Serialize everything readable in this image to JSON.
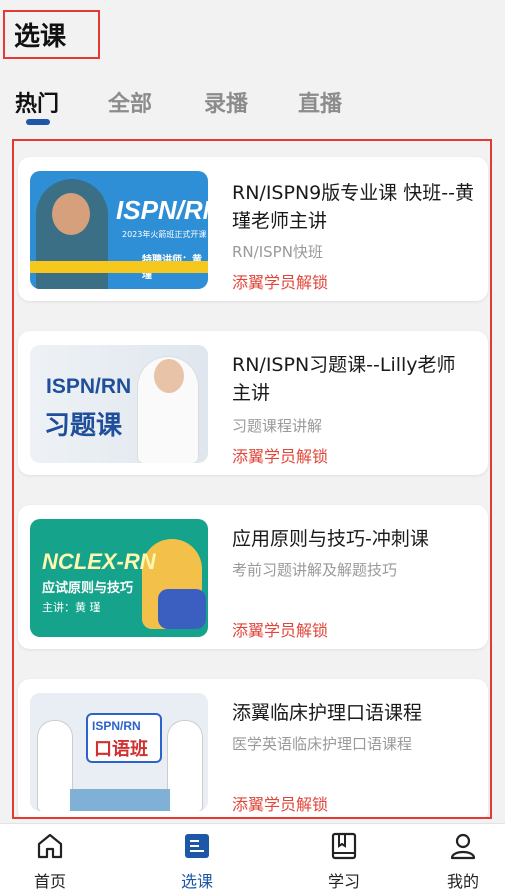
{
  "header": {
    "title": "选课"
  },
  "tabs": [
    {
      "label": "热门",
      "active": true
    },
    {
      "label": "全部",
      "active": false
    },
    {
      "label": "录播",
      "active": false
    },
    {
      "label": "直播",
      "active": false
    }
  ],
  "courses": [
    {
      "title": "RN/ISPN9版专业课 快班--黄瑾老师主讲",
      "subtitle": "RN/ISPN快班",
      "action": "添翼学员解锁",
      "thumb": {
        "line1": "ISPN/RN",
        "line2": "2023年火箭班正式开课",
        "line3": "特聘讲师：黄瑾"
      }
    },
    {
      "title": "RN/ISPN习题课--Lilly老师主讲",
      "subtitle": "习题课程讲解",
      "action": "添翼学员解锁",
      "thumb": {
        "line1": "ISPN/RN",
        "line2": "习题课"
      }
    },
    {
      "title": "应用原则与技巧-冲刺课",
      "subtitle": "考前习题讲解及解题技巧",
      "action": "添翼学员解锁",
      "thumb": {
        "line1": "NCLEX-RN",
        "line2": "应试原则与技巧",
        "line3": "主讲：黄 瑾"
      }
    },
    {
      "title": "添翼临床护理口语课程",
      "subtitle": "医学英语临床护理口语课程",
      "action": "添翼学员解锁",
      "thumb": {
        "line1": "ISPN/RN",
        "line2": "口语班"
      }
    }
  ],
  "bottom_nav": [
    {
      "label": "首页",
      "icon": "home-icon",
      "active": false
    },
    {
      "label": "选课",
      "icon": "course-list-icon",
      "active": true
    },
    {
      "label": "学习",
      "icon": "book-icon",
      "active": false
    },
    {
      "label": "我的",
      "icon": "user-icon",
      "active": false
    }
  ],
  "colors": {
    "accent": "#1e57a8",
    "lock": "#e0463b",
    "highlight_border": "#e53935"
  }
}
